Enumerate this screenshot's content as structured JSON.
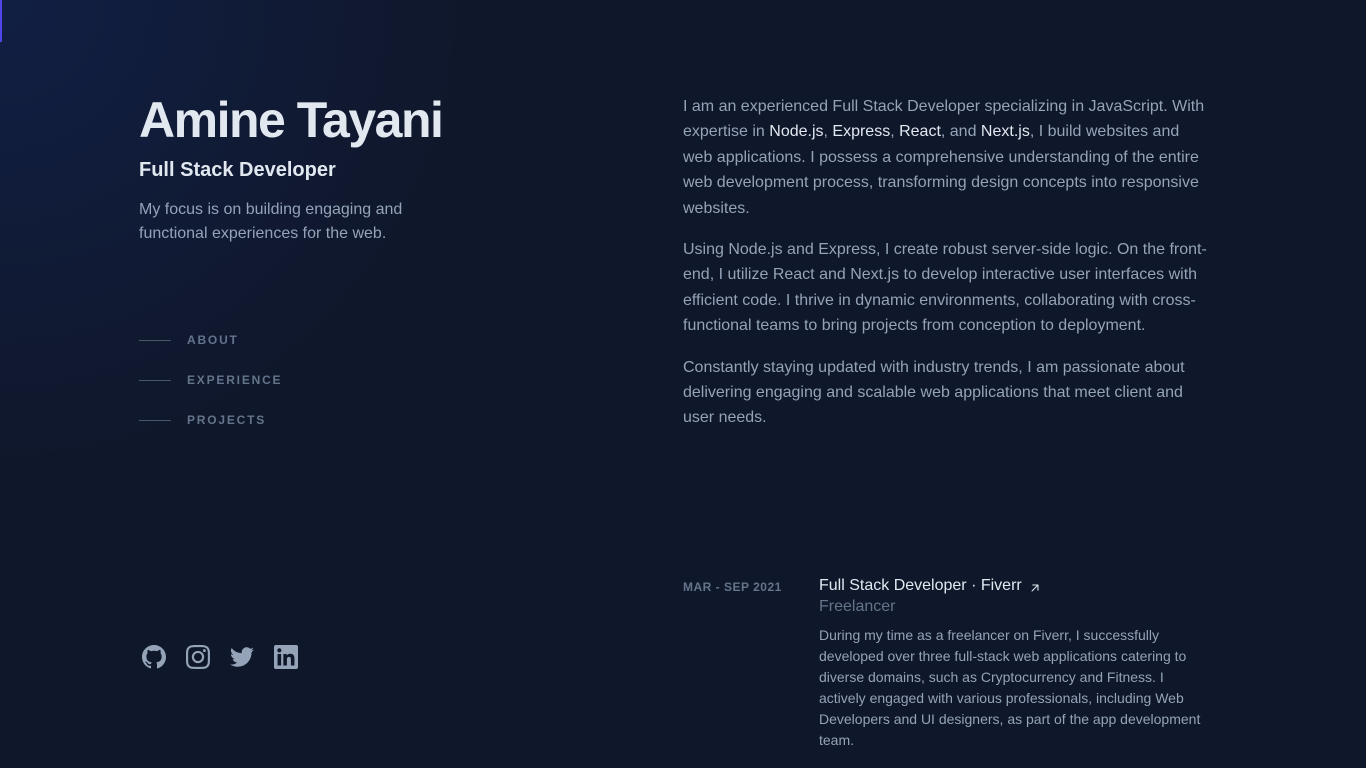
{
  "header": {
    "name": "Amine Tayani",
    "role": "Full Stack Developer",
    "tagline": "My focus is on building engaging and functional experiences for the web."
  },
  "nav": {
    "items": [
      {
        "label": "ABOUT"
      },
      {
        "label": "EXPERIENCE"
      },
      {
        "label": "PROJECTS"
      }
    ]
  },
  "socials": {
    "icons": [
      "github-icon",
      "instagram-icon",
      "twitter-icon",
      "linkedin-icon"
    ]
  },
  "about": {
    "p1_a": "I am an experienced Full Stack Developer specializing in JavaScript. With expertise in ",
    "tech1": "Node.js",
    "sep1": ", ",
    "tech2": "Express",
    "sep2": ", ",
    "tech3": "React",
    "sep3": ", and ",
    "tech4": "Next.js",
    "p1_b": ", I build websites and web applications. I possess a comprehensive understanding of the entire web development process, transforming design concepts into responsive websites.",
    "p2": "Using Node.js and Express, I create robust server-side logic. On the front-end, I utilize React and Next.js to develop interactive user interfaces with efficient code. I thrive in dynamic environments, collaborating with cross-functional teams to bring projects from conception to deployment.",
    "p3": "Constantly staying updated with industry trends, I am passionate about delivering engaging and scalable web applications that meet client and user needs."
  },
  "experience": {
    "items": [
      {
        "date": "MAR - SEP 2021",
        "title": "Full Stack Developer · Fiverr",
        "subtitle": "Freelancer",
        "description": "During my time as a freelancer on Fiverr, I successfully developed over three full-stack web applications catering to diverse domains, such as Cryptocurrency and Fitness. I actively engaged with various professionals, including Web Developers and UI designers, as part of the app development team."
      }
    ]
  },
  "colors": {
    "background": "#0f172a",
    "heading": "#e2e8f0",
    "body": "#94a3b8",
    "muted": "#64748b",
    "accent": "#4f46e5"
  }
}
